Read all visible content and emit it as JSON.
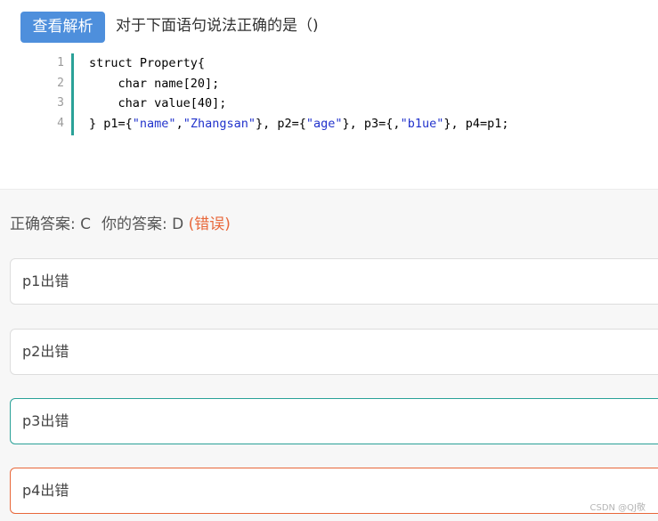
{
  "header": {
    "analysis_button": "查看解析",
    "question": "对于下面语句说法正确的是（)"
  },
  "code": {
    "line_numbers": [
      "1",
      "2",
      "3",
      "4"
    ],
    "line1": "struct Property{",
    "line2": "    char name[20];",
    "line3": "    char value[40];",
    "line4": {
      "a": "} p1={",
      "s1": "\"name\"",
      "b": ",",
      "s2": "\"Zhangsan\"",
      "c": "}, p2={",
      "s3": "\"age\"",
      "d": "}, p3={,",
      "s4": "\"b1ue\"",
      "e": "}, p4=p1;"
    }
  },
  "answer": {
    "correct_label": "正确答案: C",
    "yours_label": "你的答案: D",
    "status": "(错误)"
  },
  "options": [
    {
      "label": "p1出错",
      "state": "normal"
    },
    {
      "label": "p2出错",
      "state": "normal"
    },
    {
      "label": "p3出错",
      "state": "correct"
    },
    {
      "label": "p4出错",
      "state": "incorrect"
    }
  ],
  "watermark": "CSDN @QJ敬",
  "colors": {
    "button": "#4e8fdc",
    "code_string": "#2233cc",
    "correct_border": "#2aa198",
    "incorrect_border": "#e8673a"
  }
}
